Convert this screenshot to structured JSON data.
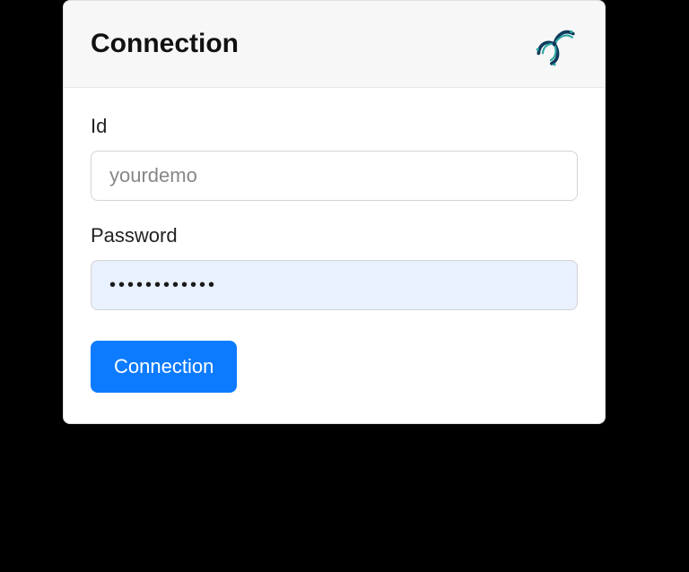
{
  "card": {
    "title": "Connection",
    "logo_name": "turbine-logo-icon"
  },
  "form": {
    "id": {
      "label": "Id",
      "placeholder": "yourdemo",
      "value": ""
    },
    "password": {
      "label": "Password",
      "value": "••••••••••••"
    },
    "submit_label": "Connection"
  }
}
